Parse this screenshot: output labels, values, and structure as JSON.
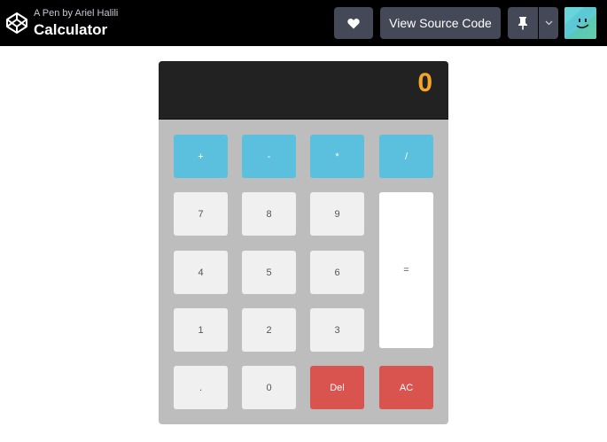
{
  "header": {
    "byline": "A Pen by Ariel Halili",
    "title": "Calculator",
    "view_source_label": "View Source Code"
  },
  "calculator": {
    "display": "0",
    "ops": [
      "+",
      "-",
      "*",
      "/"
    ],
    "keys": {
      "k7": "7",
      "k8": "8",
      "k9": "9",
      "k4": "4",
      "k5": "5",
      "k6": "6",
      "k1": "1",
      "k2": "2",
      "k3": "3",
      "dot": ".",
      "k0": "0",
      "del": "Del",
      "ac": "AC",
      "eq": "="
    }
  },
  "colors": {
    "operator": "#5bc0de",
    "danger": "#d9534f",
    "display_text": "#f5a623",
    "display_bg": "#222222"
  }
}
